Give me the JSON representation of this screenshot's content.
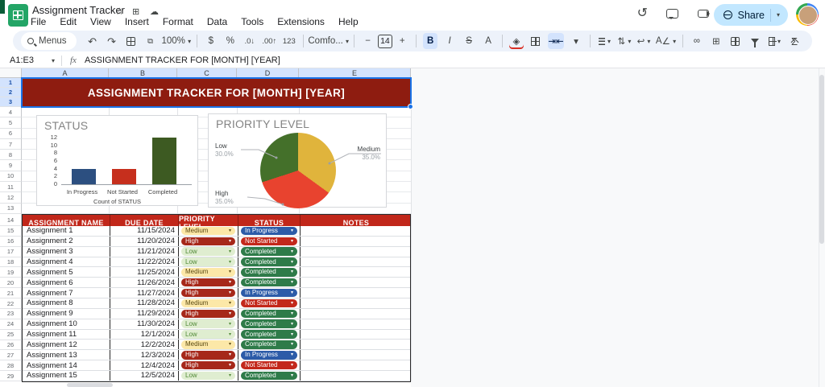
{
  "titlebar": {
    "doc_title": "Assignment Tracker",
    "menus": [
      "File",
      "Edit",
      "View",
      "Insert",
      "Format",
      "Data",
      "Tools",
      "Extensions",
      "Help"
    ],
    "share_label": "Share"
  },
  "toolbar": {
    "menus_label": "Menus",
    "zoom_level": "100%",
    "currency": "$",
    "percent": "%",
    "dec_decrease": ".0",
    "dec_increase": ".00",
    "more_formats": "123",
    "font_name": "Comfo...",
    "minus": "−",
    "font_size": "14",
    "plus": "+",
    "bold": "B",
    "italic": "I",
    "strikethrough": "S",
    "text_color": "A",
    "rotate": "A",
    "sum": "Σ"
  },
  "formula_bar": {
    "name_box": "A1:E3",
    "fx": "fx",
    "formula": "ASSIGNMENT TRACKER FOR [MONTH] [YEAR]"
  },
  "sheet": {
    "columns": [
      "A",
      "B",
      "C",
      "D",
      "E"
    ],
    "first_row": 1,
    "last_row": 29,
    "banner_text": "ASSIGNMENT TRACKER FOR [MONTH] [YEAR]",
    "selected_rows": [
      1,
      2,
      3
    ]
  },
  "chart_data": [
    {
      "type": "bar",
      "title": "STATUS",
      "categories": [
        "In Progress",
        "Not Started",
        "Completed"
      ],
      "values": [
        4,
        4,
        12
      ],
      "colors": [
        "#2c4f80",
        "#c62f1d",
        "#3d5a22"
      ],
      "xlabel": "Count of STATUS",
      "ylabel": "",
      "ylim": [
        0,
        12
      ],
      "ytick_step": 2,
      "grid": false,
      "legend": "none"
    },
    {
      "type": "pie",
      "title": "PRIORITY LEVEL",
      "categories": [
        "Medium",
        "High",
        "Low"
      ],
      "values": [
        35,
        35,
        30
      ],
      "value_labels": [
        "35.0%",
        "35.0%",
        "30.0%"
      ],
      "colors": [
        "#e0b43c",
        "#e8432f",
        "#44702a"
      ],
      "start_angle_deg": 0,
      "direction": "clockwise",
      "legend": "outside-labels"
    }
  ],
  "table": {
    "headers": [
      "ASSIGNMENT NAME",
      "DUE DATE",
      "PRIORITY LEVEL",
      "STATUS",
      "NOTES"
    ],
    "rows": [
      {
        "name": "Assignment 1",
        "due_date": "11/15/2024",
        "priority": "Medium",
        "status": "In Progress",
        "notes": ""
      },
      {
        "name": "Assignment 2",
        "due_date": "11/20/2024",
        "priority": "High",
        "status": "Not Started",
        "notes": ""
      },
      {
        "name": "Assignment 3",
        "due_date": "11/21/2024",
        "priority": "Low",
        "status": "Completed",
        "notes": ""
      },
      {
        "name": "Assignment 4",
        "due_date": "11/22/2024",
        "priority": "Low",
        "status": "Completed",
        "notes": ""
      },
      {
        "name": "Assignment 5",
        "due_date": "11/25/2024",
        "priority": "Medium",
        "status": "Completed",
        "notes": ""
      },
      {
        "name": "Assignment 6",
        "due_date": "11/26/2024",
        "priority": "High",
        "status": "Completed",
        "notes": ""
      },
      {
        "name": "Assignment 7",
        "due_date": "11/27/2024",
        "priority": "High",
        "status": "In Progress",
        "notes": ""
      },
      {
        "name": "Assignment 8",
        "due_date": "11/28/2024",
        "priority": "Medium",
        "status": "Not Started",
        "notes": ""
      },
      {
        "name": "Assignment 9",
        "due_date": "11/29/2024",
        "priority": "High",
        "status": "Completed",
        "notes": ""
      },
      {
        "name": "Assignment 10",
        "due_date": "11/30/2024",
        "priority": "Low",
        "status": "Completed",
        "notes": ""
      },
      {
        "name": "Assignment 11",
        "due_date": "12/1/2024",
        "priority": "Low",
        "status": "Completed",
        "notes": ""
      },
      {
        "name": "Assignment 12",
        "due_date": "12/2/2024",
        "priority": "Medium",
        "status": "Completed",
        "notes": ""
      },
      {
        "name": "Assignment 13",
        "due_date": "12/3/2024",
        "priority": "High",
        "status": "In Progress",
        "notes": ""
      },
      {
        "name": "Assignment 14",
        "due_date": "12/4/2024",
        "priority": "High",
        "status": "Not Started",
        "notes": ""
      },
      {
        "name": "Assignment 15",
        "due_date": "12/5/2024",
        "priority": "Low",
        "status": "Completed",
        "notes": ""
      }
    ]
  },
  "colors": {
    "banner_bg": "#8e1c10",
    "table_header_bg": "#c1271a",
    "selection_blue": "#1a73e8",
    "selected_header_bg": "#d3e3fd",
    "toolbar_bg": "#edf2fa",
    "share_pill_bg": "#c2e7ff",
    "priority": {
      "Medium": "#fce8a8",
      "High": "#a6281a",
      "Low": "#dfedd0"
    },
    "status": {
      "In Progress": "#2c5ba8",
      "Not Started": "#c3281b",
      "Completed": "#2e7b49"
    }
  }
}
